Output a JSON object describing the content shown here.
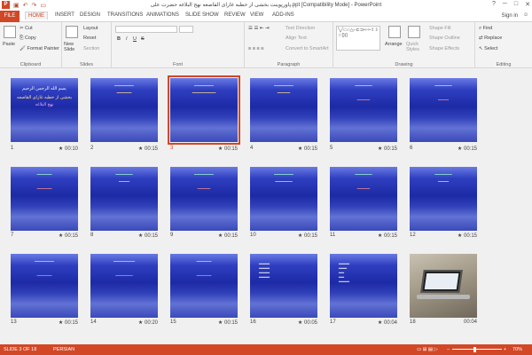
{
  "titlebar": {
    "title": "پاورپوینت بخشی از خطبه غارای القاصعه نهج البلاغه حضرت علی.ppt [Compatibility Mode] - PowerPoint",
    "help": "?",
    "min": "─",
    "max": "□",
    "close": "✕"
  },
  "tabs": [
    "FILE",
    "HOME",
    "INSERT",
    "DESIGN",
    "TRANSITIONS",
    "ANIMATIONS",
    "SLIDE SHOW",
    "REVIEW",
    "VIEW",
    "ADD-INS"
  ],
  "user": "Sign in",
  "ribbon": {
    "clipboard": {
      "paste": "Paste",
      "cut": "Cut",
      "copy": "Copy",
      "format_painter": "Format Painter",
      "label": "Clipboard"
    },
    "slides": {
      "new_slide": "New Slide",
      "layout": "Layout",
      "reset": "Reset",
      "section": "Section",
      "label": "Slides"
    },
    "font": {
      "bold": "B",
      "italic": "I",
      "underline": "U",
      "strike": "S",
      "label": "Font"
    },
    "paragraph": {
      "text_direction": "Text Direction",
      "align_text": "Align Text",
      "convert": "Convert to SmartArt",
      "label": "Paragraph"
    },
    "drawing": {
      "arrange": "Arrange",
      "quick_styles": "Quick Styles",
      "shape_fill": "Shape Fill",
      "shape_outline": "Shape Outline",
      "shape_effects": "Shape Effects",
      "label": "Drawing"
    },
    "editing": {
      "find": "Find",
      "replace": "Replace",
      "select": "Select",
      "label": "Editing"
    }
  },
  "slides": [
    {
      "n": "1",
      "time": "00:10",
      "star": "★",
      "l1": "بسم الله الرحمن الرحیم",
      "l2": "بخشی از خطبه غارای القاصعه",
      "l3": "نهج البلاغه"
    },
    {
      "n": "2",
      "time": "00:15",
      "star": "★",
      "l1": "",
      "l2": "",
      "l3": ""
    },
    {
      "n": "3",
      "time": "00:15",
      "star": "★",
      "l1": "",
      "l2": "",
      "l3": ""
    },
    {
      "n": "4",
      "time": "00:15",
      "star": "★",
      "l1": "",
      "l2": "",
      "l3": ""
    },
    {
      "n": "5",
      "time": "00:15",
      "star": "★",
      "l1": "",
      "l2": "",
      "l3": ""
    },
    {
      "n": "6",
      "time": "00:15",
      "star": "★",
      "l1": "",
      "l2": "",
      "l3": ""
    },
    {
      "n": "7",
      "time": "00:15",
      "star": "★",
      "l1": "",
      "l2": "",
      "l3": ""
    },
    {
      "n": "8",
      "time": "00:15",
      "star": "★",
      "l1": "",
      "l2": "",
      "l3": ""
    },
    {
      "n": "9",
      "time": "00:15",
      "star": "★",
      "l1": "",
      "l2": "",
      "l3": ""
    },
    {
      "n": "10",
      "time": "00:15",
      "star": "★",
      "l1": "",
      "l2": "",
      "l3": ""
    },
    {
      "n": "11",
      "time": "00:15",
      "star": "★",
      "l1": "",
      "l2": "",
      "l3": ""
    },
    {
      "n": "12",
      "time": "00:15",
      "star": "★",
      "l1": "",
      "l2": "",
      "l3": ""
    },
    {
      "n": "13",
      "time": "00:15",
      "star": "★",
      "l1": "",
      "l2": "",
      "l3": ""
    },
    {
      "n": "14",
      "time": "00:20",
      "star": "★",
      "l1": "",
      "l2": "",
      "l3": ""
    },
    {
      "n": "15",
      "time": "00:15",
      "star": "★",
      "l1": "",
      "l2": "",
      "l3": ""
    },
    {
      "n": "16",
      "time": "00:05",
      "star": "★",
      "l1": "",
      "l2": "",
      "l3": ""
    },
    {
      "n": "17",
      "time": "00:04",
      "star": "★",
      "l1": "",
      "l2": "",
      "l3": ""
    },
    {
      "n": "18",
      "time": "00:04",
      "star": "★",
      "l1": "",
      "l2": "",
      "l3": ""
    }
  ],
  "status": {
    "slide": "SLIDE 3 OF 18",
    "lang": "PERSIAN",
    "zoom": "70%"
  },
  "colors": {
    "accent": "#d24726"
  }
}
